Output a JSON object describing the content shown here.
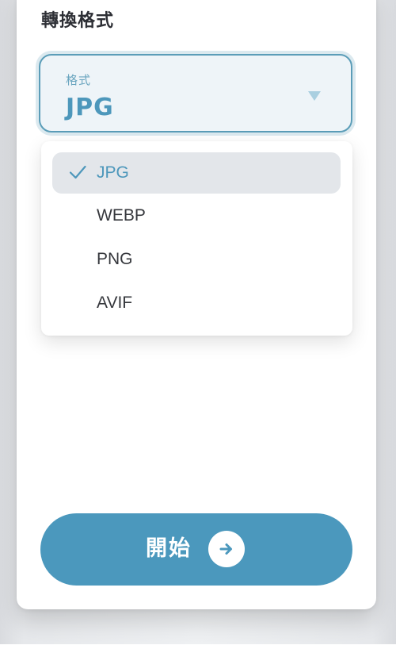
{
  "section": {
    "title": "轉換格式"
  },
  "format_select": {
    "label": "格式",
    "value": "JPG",
    "options": [
      {
        "label": "JPG",
        "selected": true
      },
      {
        "label": "WEBP",
        "selected": false
      },
      {
        "label": "PNG",
        "selected": false
      },
      {
        "label": "AVIF",
        "selected": false
      }
    ]
  },
  "start_button": {
    "label": "開始",
    "icon": "arrow-right-icon"
  },
  "colors": {
    "accent": "#4b98bd",
    "accent_text": "#4d97bb",
    "selected_option_bg": "#e3e6ea",
    "text": "#2d2f35"
  }
}
